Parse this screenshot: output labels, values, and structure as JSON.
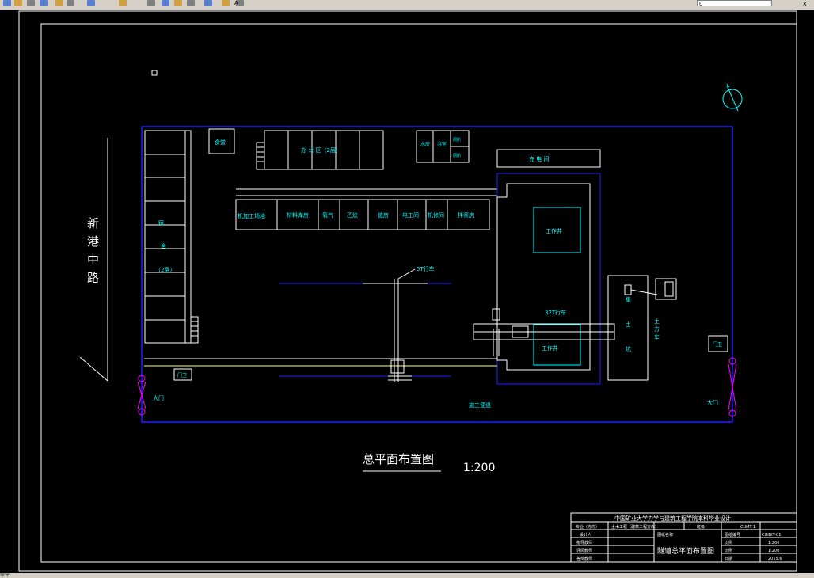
{
  "toolbar": {
    "buttons": [
      "new-icon",
      "open-icon",
      "save-icon",
      "print-icon",
      "undo-icon",
      "redo-icon",
      "pan-icon",
      "zoom-realtime-icon",
      "zoom-window-icon",
      "zoom-previous-icon",
      "properties-icon",
      "text-style-icon",
      "table-icon",
      "layer-icon",
      "color-icon"
    ],
    "text_style_label": "A",
    "layer_combo": "0",
    "close_label": "x"
  },
  "colors": {
    "cyan": "#00ffff",
    "blue": "#2020ff",
    "white": "#ffffff",
    "magenta": "#ff00ff",
    "yellow": "#ffff66",
    "background": "#000000"
  },
  "drawing": {
    "road_name": [
      "新",
      "港",
      "中",
      "路"
    ],
    "canteen": "食堂",
    "office": "办 公 区（2层）",
    "water_room": "水房",
    "bath_room": "浴室",
    "toilet": [
      "厕所",
      "厕所"
    ],
    "charging_room": "充 电 间",
    "workshops": [
      "机加工场地",
      "材料库房",
      "氧气",
      "乙炔",
      "值房",
      "电工间",
      "机修间",
      "拌浆房"
    ],
    "dorm": [
      "宿",
      "舍",
      "（2层）"
    ],
    "crane_5t": "5T行车",
    "crane_32t": "32T行车",
    "shaft_top": "工作井",
    "shaft_bottom": "工作井",
    "muck_pit": [
      "集",
      "土",
      "坑"
    ],
    "muck_truck": [
      "土",
      "方",
      "车"
    ],
    "guard_left": "门卫",
    "guard_right": "门卫",
    "gate_left": "大门",
    "gate_right": "大门",
    "road_label": "施工便道",
    "title": "总平面布置图",
    "scale": "1:200"
  },
  "title_block": {
    "school": "中国矿业大学力学与建筑工程学院本科毕业设计",
    "rows": [
      [
        "专业（方向）",
        "土木工程（建筑工程方向）",
        "班级",
        "",
        "图纸编号",
        "CUMT-1"
      ],
      [
        "设计人",
        "",
        "图纸名称",
        "",
        "图号",
        "CHIBIT-01"
      ],
      [
        "指导教师",
        "",
        "",
        "",
        "比例",
        "1:200"
      ],
      [
        "评阅教师",
        "",
        "",
        "",
        "比例",
        "1:200"
      ],
      [
        "答辩教师",
        "",
        "",
        "",
        "日期",
        "2015.6"
      ]
    ],
    "sheet_title": "隧道总平面布置图"
  },
  "statusbar": {
    "text": "命令:"
  }
}
